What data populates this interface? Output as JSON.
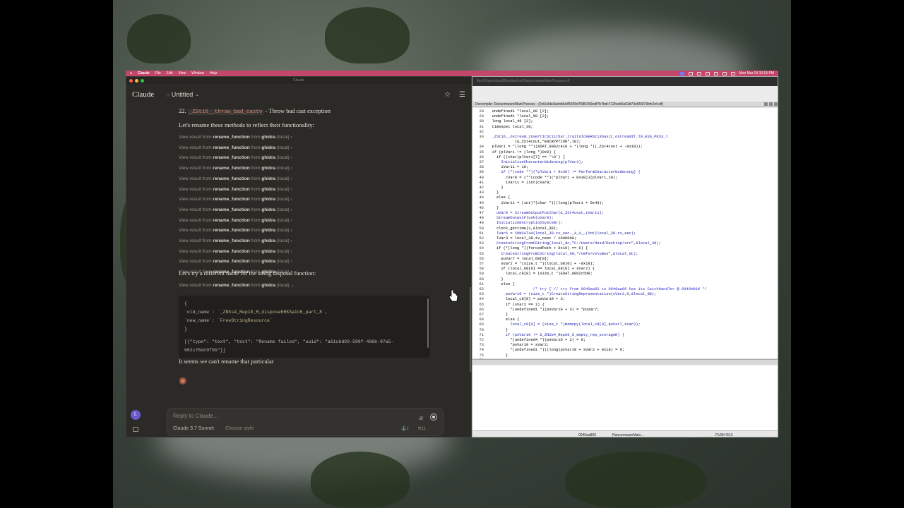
{
  "menubar": {
    "app": "Claude",
    "items": [
      "File",
      "Edit",
      "View",
      "Window",
      "Help"
    ],
    "datetime": "Mon Mar 24  10:15 PM"
  },
  "claude": {
    "window_title": "Claude",
    "brand": "Claude",
    "conversation_title": "Untitled",
    "item_22_number": "22.",
    "item_22_code": "_ZSt16__throw_bad_castv",
    "item_22_text": " - Throw bad cast exception",
    "para1": "Let's rename these methods to reflect their functionality:",
    "view_result": {
      "prefix": "View result from ",
      "fn": "rename_function",
      "mid": " from ",
      "server": "ghidra",
      "suffix": " (local) ›"
    },
    "view_result_count": 14,
    "para2": "Let's try a different name for the string disposal function:",
    "last_view_suffix": " (local) ⌄",
    "code": {
      "open": "{",
      "old_name_key": "  `old_name`: ",
      "old_name_val": "`_ZNSs4_Rep10_M_disposeERKSaIcE_part_8`,",
      "new_name_key": "  `new_name`: ",
      "new_name_val": "`FreeStringResource`",
      "close": "}",
      "result1": "[{\"type\": \"text\", \"text\": \"Rename failed\", \"uuid\": \"a61cbd93-599f-496b-97a5-",
      "result2": "662c76dc0f9b\"}]"
    },
    "para3": "It seems we can't rename that particular",
    "reply_placeholder": "Reply to Claude...",
    "model": "Claude 3.7 Sonnet",
    "style": "Choose style",
    "stat1": "⚓1",
    "stat2": "⚒11",
    "avatar": "L"
  },
  "ghidra": {
    "top_ghost": "file:///Users/dssd/Desktop/src/RansomwareMainProcess.elf",
    "decompile_title": "Decompile: RansomwareMainProcess -  (0c6c3de3aebb6e85939d7588150edf7b7bdc712fceb6a63d79e656f79bfc2ef.elf)",
    "code_lines": [
      [
        "28",
        "  undefined1 *local_68 [2];"
      ],
      [
        "29",
        "  undefined1 *local_58 [2];"
      ],
      [
        "30",
        "  long local_48 [2];"
      ],
      [
        "31",
        "  timespec local_38;"
      ],
      [
        "32",
        ""
      ],
      [
        "33",
        "  _ZSt16__ostream_insertIcSt11char_traitsIcEERSt13basic_ostreamIT_T0_ES6_PKS3_l"
      ],
      [
        "",
        "            (&_ZSt4cout,\"ENCRYPTION\",10);"
      ],
      [
        "34",
        "  plVar1 = *(long **)(&DAT_0062c410 + *(long *)(_ZSt4cout + -0x18));"
      ],
      [
        "35",
        "  if (plVar1 != (long *)0x0) {"
      ],
      [
        "36",
        "    if ((char)plVar1[7] == '\\0') {"
      ],
      [
        "37",
        "      InitializeCharacterWidening(plVar1);"
      ],
      [
        "38",
        "      iVar11 = 10;"
      ],
      [
        "39",
        "      if (*(code **)(*plVar1 + 0x30) != PerformCharacterWidening) {"
      ],
      [
        "40",
        "        cVar8 = (**(code **)(*plVar1 + 0x30))(plVar1,10);"
      ],
      [
        "41",
        "        iVar11 = (int)cVar8;"
      ],
      [
        "42",
        "      }"
      ],
      [
        "43",
        "    }"
      ],
      [
        "44",
        "    else {"
      ],
      [
        "45",
        "      iVar11 = (int)*(char *)((long)plVar1 + 0x43);"
      ],
      [
        "46",
        "    }"
      ],
      [
        "47",
        "    uVar9 = StreamOutputPutChar(&_ZSt4cout,iVar11);"
      ],
      [
        "48",
        "    StreamOutputFlush(uVar9);"
      ],
      [
        "49",
        "    InitializeEncryptionSystem();"
      ],
      [
        "50",
        "    clock_gettime(1,&local_38);"
      ],
      [
        "51",
        "    lVar5 = CONCAT44(local_38.tv_sec._4_4_,(int)local_38.tv_sec);"
      ],
      [
        "52",
        "    lVar3 = local_38.tv_nsec / 1000000;"
      ],
      [
        "53",
        "    CreateStringFromCString(local_dc,\"C:/Users/dssd/Desktop/src\",&local_38);"
      ],
      [
        "54",
        "    if (*(long *)(forcedPath + 0x10) == 0) {"
      ],
      [
        "55",
        "      CreateStringFromCString(local_68,\"/vmfs/volumes\",&local_dc);"
      ],
      [
        "56",
        "      puVar7 = local_68[0];"
      ],
      [
        "57",
        "      sVar2 = *(size_t *)(local_68[0] + -0x18);"
      ],
      [
        "58",
        "      if (local_68[0] == local_68[0] + sVar2) {"
      ],
      [
        "59",
        "        local_c8[0] = (size_t *)&DAT_0062c5d8;"
      ],
      [
        "60",
        "      }"
      ],
      [
        "61",
        "      else {"
      ],
      [
        "62",
        "                    /* try { // try from 0040aa82 to 0040aa86 has its CatchHandler @ 0040b00d */"
      ],
      [
        "63",
        "        psVar10 = (size_t *)CreateStringRepresentation(sVar2,0,&local_db);"
      ],
      [
        "64",
        "        local_c8[0] = psVar10 + 3;"
      ],
      [
        "65",
        "        if (sVar2 == 1) {"
      ],
      [
        "66",
        "          *(undefined1 *)(psVar10 + 3) = *puVar7;"
      ],
      [
        "67",
        "        }"
      ],
      [
        "68",
        "        else {"
      ],
      [
        "69",
        "          local_c8[0] = (size_t *)memcpy(local_c8[0],puVar7,sVar2);"
      ],
      [
        "70",
        "        }"
      ],
      [
        "71",
        "        if (psVar10 != &_ZNSs4_Rep20_S_empty_rep_storageE) {"
      ],
      [
        "72",
        "          *(undefined4 *)(psVar10 + 2) = 0;"
      ],
      [
        "73",
        "          *psVar10 = sVar2;"
      ],
      [
        "74",
        "          *(undefined1 *)((long)psVar10 + sVar2 + 0x18) = 0;"
      ],
      [
        "75",
        "        }"
      ],
      [
        "76",
        ""
      ]
    ],
    "status_addr": "0040aa860",
    "status_fn": "RansomwareMain...",
    "status_instr": "PUSH R13"
  }
}
